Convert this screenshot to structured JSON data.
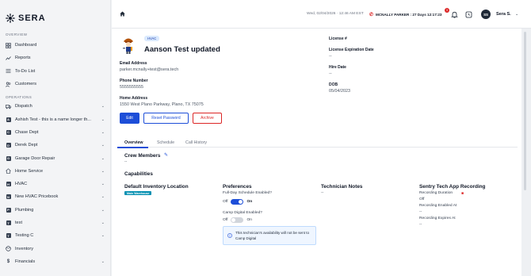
{
  "brand": {
    "name": "SERA",
    "accent": "#1d4ed8",
    "danger": "#dc2626"
  },
  "sidebar": {
    "overview_label": "OVERVIEW",
    "overview_items": [
      {
        "label": "Dashboard",
        "icon": "dashboard-icon"
      },
      {
        "label": "Reports",
        "icon": "reports-icon"
      },
      {
        "label": "To-Do List",
        "icon": "todo-icon"
      },
      {
        "label": "Customers",
        "icon": "customers-icon"
      }
    ],
    "operations_label": "OPERATIONS",
    "operations_items": [
      {
        "label": "Dispatch",
        "icon": "truck-icon",
        "chevron": true
      },
      {
        "label": "Ashish Test - this is a name longer th...",
        "badge": "A",
        "chevron": true
      },
      {
        "label": "Chase Dept",
        "badge": "C",
        "chevron": true
      },
      {
        "label": "Derek Dept",
        "badge": "D",
        "chevron": true
      },
      {
        "label": "Garage Door Repair",
        "badge": "G",
        "chevron": true
      },
      {
        "label": "Home Service",
        "icon": "house-icon",
        "chevron": true
      },
      {
        "label": "HVAC",
        "badge": "H",
        "chevron": true
      },
      {
        "label": "New HVAC Pricebook",
        "badge": "N",
        "chevron": true
      },
      {
        "label": "Plumbing",
        "badge": "P",
        "chevron": true
      },
      {
        "label": "test",
        "badge": "T",
        "chevron": true
      },
      {
        "label": "Testing C",
        "badge": "T",
        "chevron": true
      },
      {
        "label": "Inventory",
        "icon": "inventory-icon",
        "chevron": false
      },
      {
        "label": "Financials",
        "icon": "dollar-icon",
        "chevron": true
      }
    ]
  },
  "header": {
    "datetime": "Wed, 02/04/2026 · 12:46 AM EST",
    "timer_text": "MCNALLY PARKER : 27 Days 12:17:23",
    "notification_count": "3",
    "avatar_initials": "SS",
    "user_name": "Sera S."
  },
  "technician": {
    "tag": "HVAC",
    "name": "Aanson Test updated",
    "email_label": "Email Address",
    "email": "parker.mcnally+test@sera.tech",
    "phone_label": "Phone Number",
    "phone": "5555555555",
    "home_label": "Home Address",
    "home": "1550 West Plano Parkway, Plano, TX 75075",
    "license_label": "License #",
    "license_exp_label": "License Expiration Date",
    "license_exp": "--",
    "hire_label": "Hire Date",
    "hire": "--",
    "dob_label": "DOB",
    "dob": "05/04/2023"
  },
  "actions": {
    "edit": "Edit",
    "reset": "Reset Password",
    "archive": "Archive"
  },
  "tabs": [
    {
      "label": "Overview",
      "active": true
    },
    {
      "label": "Schedule",
      "active": false
    },
    {
      "label": "Call History",
      "active": false
    }
  ],
  "overview": {
    "crew_title": "Crew Members",
    "crew_value": "--",
    "capabilities_title": "Capabilities",
    "inventory_title": "Default Inventory Location",
    "inventory_badge": "Main Warehouse",
    "preferences_title": "Preferences",
    "full_day_q": "Full-Day Schedule Enabled?",
    "full_day_off": "Off",
    "full_day_on": "On",
    "full_day_state": "on",
    "camp_q": "Camp Digital Enabled?",
    "camp_off": "Off",
    "camp_on": "On",
    "camp_state": "off",
    "info_text": "This technician's availability will not be sent to Camp Digital",
    "notes_title": "Technician Notes",
    "notes_value": "--",
    "sentry_title": "Sentry Tech App Recording",
    "rec_duration_label": "Recording Duration",
    "rec_duration_value": "Off",
    "rec_enabled_label": "Recording Enabled At",
    "rec_enabled_value": "--",
    "rec_expires_label": "Recording Expires At",
    "rec_expires_value": "--"
  }
}
